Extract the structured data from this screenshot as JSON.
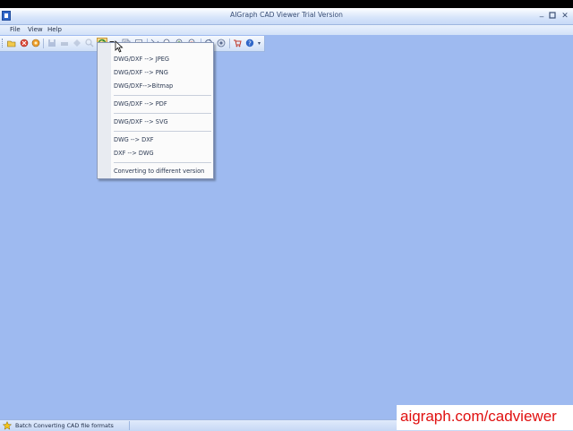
{
  "window": {
    "title": "AIGraph CAD Viewer Trial Version"
  },
  "menubar": {
    "items": [
      "File",
      "View",
      "Help"
    ]
  },
  "toolbar": {
    "icons": [
      "open-icon",
      "stop-icon",
      "refresh-icon",
      "save-icon",
      "print-icon",
      "pan-icon",
      "zoom-icon",
      "convert-icon",
      "copy-icon",
      "paste-icon",
      "select-icon",
      "zoom-window-icon",
      "zoom-in-icon",
      "zoom-out-icon",
      "rotate-icon",
      "layers-icon",
      "cart-icon",
      "help-icon"
    ]
  },
  "dropdown": {
    "items": [
      "DWG/DXF --> JPEG",
      "DWG/DXF --> PNG",
      "DWG/DXF-->Bitmap",
      "DWG/DXF --> PDF",
      "DWG/DXF --> SVG",
      "DWG --> DXF",
      "DXF --> DWG",
      "Converting to different version"
    ]
  },
  "status": {
    "text": "Batch Converting CAD file formats"
  },
  "watermark": {
    "text": "aigraph.com/cadviewer"
  },
  "colors": {
    "workspace": "#9ebaf0",
    "watermark": "#e01010"
  }
}
